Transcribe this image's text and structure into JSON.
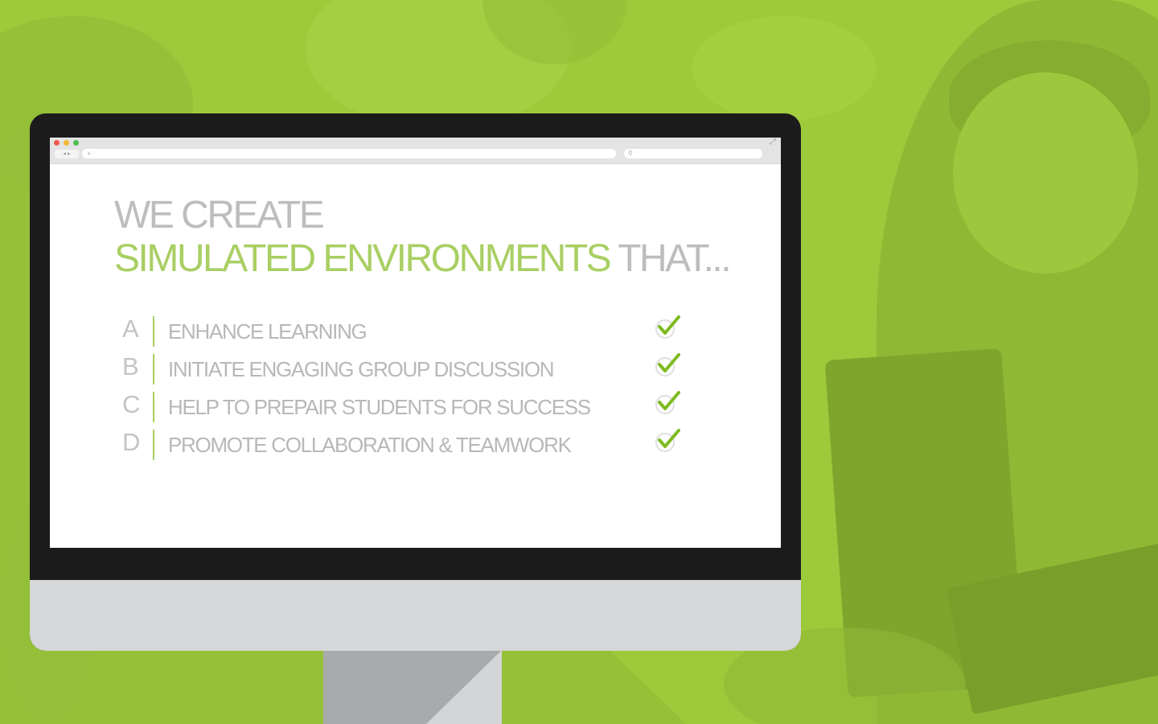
{
  "headline": {
    "line1": "WE CREATE",
    "line2_accent": "SIMULATED ENVIRONMENTS",
    "line2_rest": " THAT..."
  },
  "browser": {
    "nav_glyphs": "◂ ▸",
    "address_plus": "+",
    "search_glyph": "⚲",
    "expand_glyph": "⤢"
  },
  "items": [
    {
      "letter": "A",
      "label": "ENHANCE LEARNING",
      "checked": true
    },
    {
      "letter": "B",
      "label": "INITIATE ENGAGING GROUP DISCUSSION",
      "checked": true
    },
    {
      "letter": "C",
      "label": "HELP TO PREPAIR STUDENTS  FOR SUCCESS",
      "checked": true
    },
    {
      "letter": "D",
      "label": "PROMOTE  COLLABORATION & TEAMWORK",
      "checked": true
    }
  ],
  "colors": {
    "background_green": "#9dca3a",
    "accent_green": "#a9cf63",
    "check_green": "#7dbb1f",
    "text_gray": "#b8b8b8",
    "monitor_bezel": "#1b1b1b",
    "monitor_chin": "#d6d7d8"
  }
}
